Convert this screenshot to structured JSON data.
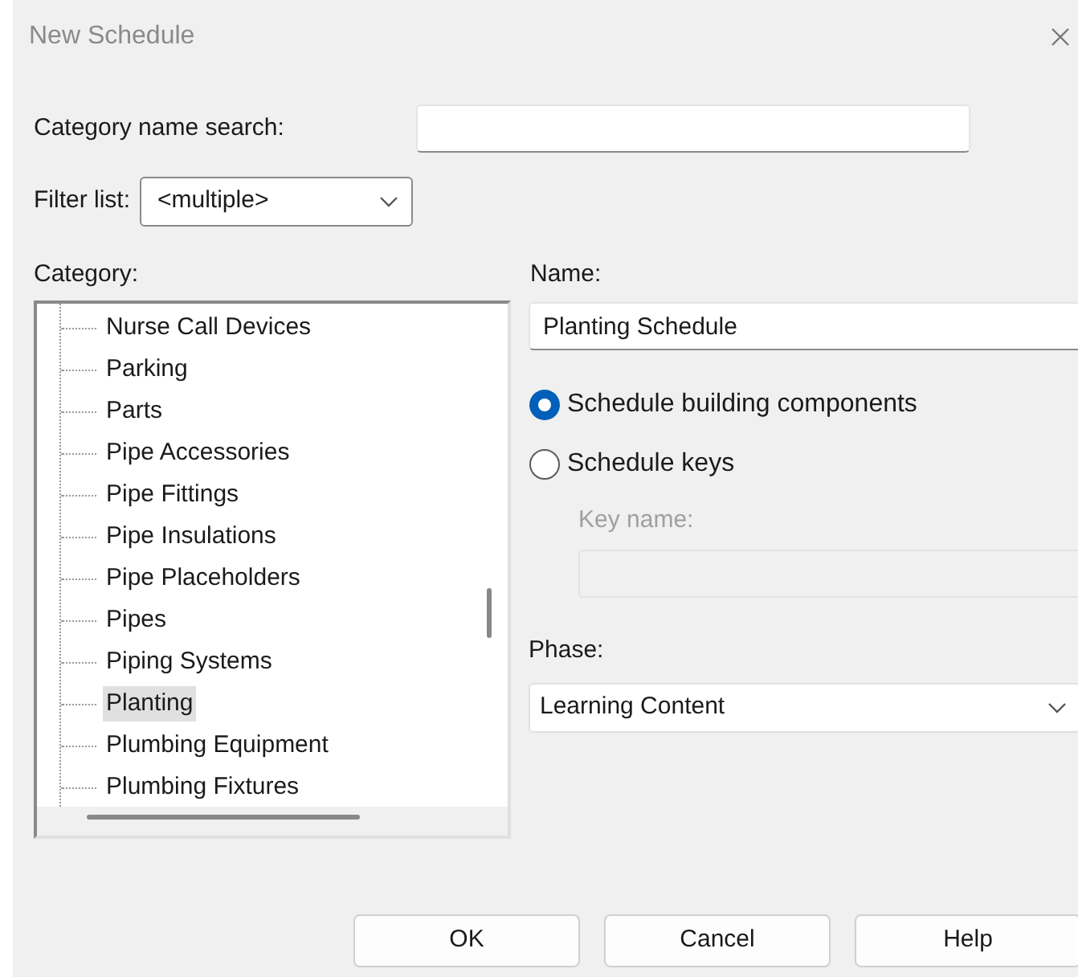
{
  "window": {
    "title": "New Schedule"
  },
  "search": {
    "label": "Category name search:"
  },
  "filter": {
    "label": "Filter list:",
    "value": "<multiple>"
  },
  "category": {
    "label": "Category:",
    "items": [
      {
        "label": "Nurse Call Devices",
        "selected": false
      },
      {
        "label": "Parking",
        "selected": false
      },
      {
        "label": "Parts",
        "selected": false
      },
      {
        "label": "Pipe Accessories",
        "selected": false
      },
      {
        "label": "Pipe Fittings",
        "selected": false
      },
      {
        "label": "Pipe Insulations",
        "selected": false
      },
      {
        "label": "Pipe Placeholders",
        "selected": false
      },
      {
        "label": "Pipes",
        "selected": false
      },
      {
        "label": "Piping Systems",
        "selected": false
      },
      {
        "label": "Planting",
        "selected": true
      },
      {
        "label": "Plumbing Equipment",
        "selected": false
      },
      {
        "label": "Plumbing Fixtures",
        "selected": false
      }
    ]
  },
  "name": {
    "label": "Name:",
    "value": "Planting Schedule"
  },
  "schedule_types": [
    {
      "label": "Schedule building components",
      "selected": true
    },
    {
      "label": "Schedule keys",
      "selected": false
    }
  ],
  "key_name": {
    "label": "Key name:",
    "disabled": true
  },
  "phase": {
    "label": "Phase:",
    "value": "Learning Content"
  },
  "buttons": [
    "OK",
    "Cancel",
    "Help"
  ]
}
